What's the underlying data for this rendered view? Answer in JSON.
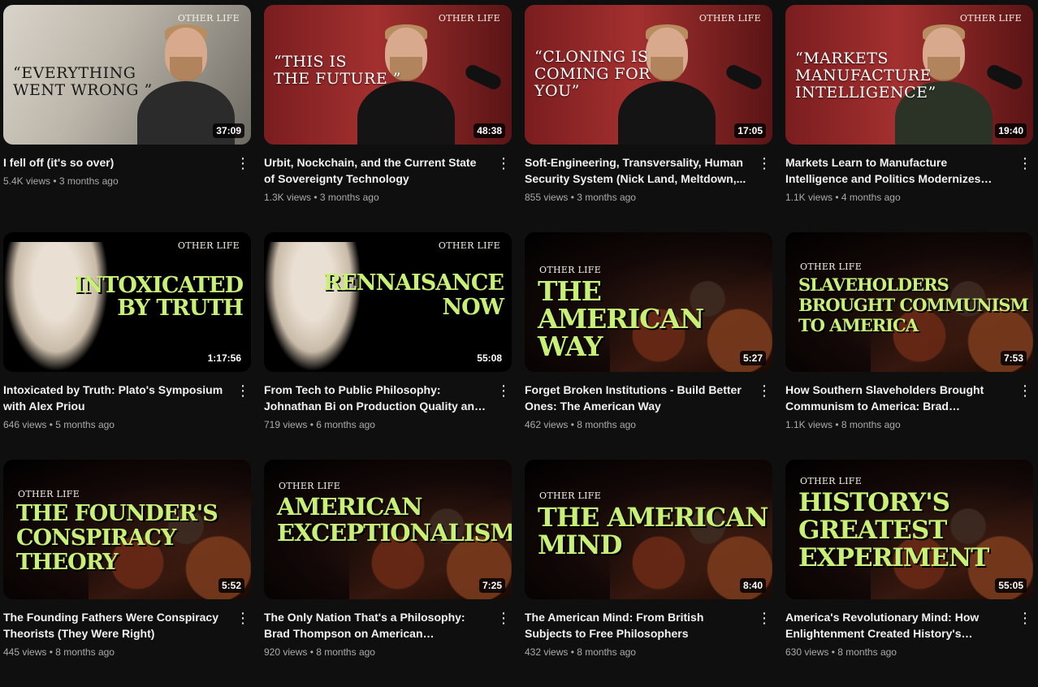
{
  "videos": [
    {
      "brand": "OTHER LIFE",
      "quote": "“EVERYTHING\nWENT WRONG ”",
      "duration": "37:09",
      "title": "I fell off (it's so over)",
      "views": "5.4K views",
      "age": "3 months ago"
    },
    {
      "brand": "OTHER LIFE",
      "quote": "“THIS IS\nTHE FUTURE ”",
      "duration": "48:38",
      "title": "Urbit, Nockchain, and the Current State of Sovereignty Technology",
      "views": "1.3K views",
      "age": "3 months ago"
    },
    {
      "brand": "OTHER LIFE",
      "quote": "“CLONING IS\nCOMING FOR\nYOU”",
      "duration": "17:05",
      "title": "Soft-Engineering, Transversality, Human Security System (Nick Land, Meltdown,...",
      "views": "855 views",
      "age": "3 months ago"
    },
    {
      "brand": "OTHER LIFE",
      "quote": "“MARKETS\nMANUFACTURE\nINTELLIGENCE”",
      "duration": "19:40",
      "title": "Markets Learn to Manufacture Intelligence and Politics Modernizes (Nick Land,...",
      "views": "1.1K views",
      "age": "4 months ago"
    },
    {
      "brand": "OTHER LIFE",
      "big": "INTOXICATED\nBY TRUTH",
      "duration": "1:17:56",
      "title": "Intoxicated by Truth: Plato's Symposium with Alex Priou",
      "views": "646 views",
      "age": "5 months ago"
    },
    {
      "brand": "OTHER LIFE",
      "big": "RENNAISANCE\nNOW",
      "duration": "55:08",
      "title": "From Tech to Public Philosophy: Johnathan Bi on Production Quality and Patronage...",
      "views": "719 views",
      "age": "6 months ago"
    },
    {
      "brand": "OTHER LIFE",
      "big": "THE AMERICAN\nWAY",
      "duration": "5:27",
      "title": "Forget Broken Institutions - Build Better Ones: The American Way",
      "views": "462 views",
      "age": "8 months ago"
    },
    {
      "brand": "OTHER LIFE",
      "big": "SLAVEHOLDERS\nBROUGHT COMMUNISM\nTO AMERICA",
      "duration": "7:53",
      "title": "How Southern Slaveholders Brought Communism to America: Brad Thompson",
      "views": "1.1K views",
      "age": "8 months ago"
    },
    {
      "brand": "OTHER LIFE",
      "big": "THE FOUNDER'S\nCONSPIRACY\nTHEORY",
      "duration": "5:52",
      "title": "The Founding Fathers Were Conspiracy Theorists (They Were Right)",
      "views": "445 views",
      "age": "8 months ago"
    },
    {
      "brand": "OTHER LIFE",
      "big": "AMERICAN\nEXCEPTIONALISM",
      "duration": "7:25",
      "title": "The Only Nation That's a Philosophy: Brad Thompson on American Exceptionalism",
      "views": "920 views",
      "age": "8 months ago"
    },
    {
      "brand": "OTHER LIFE",
      "big": "THE AMERICAN\nMIND",
      "duration": "8:40",
      "title": "The American Mind: From British Subjects to Free Philosophers",
      "views": "432 views",
      "age": "8 months ago"
    },
    {
      "brand": "OTHER LIFE",
      "big": "HISTORY'S\nGREATEST\nEXPERIMENT",
      "duration": "55:05",
      "title": "America's Revolutionary Mind: How Enlightenment Created History's Greatest...",
      "views": "630 views",
      "age": "8 months ago"
    }
  ],
  "ui": {
    "more_icon": "⋮",
    "separator": " • "
  }
}
